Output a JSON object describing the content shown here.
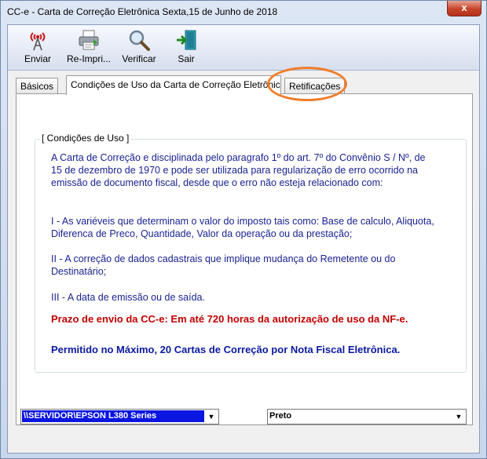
{
  "window": {
    "title": "CC-e - Carta de Correção Eletrônica Sexta,15 de Junho de 2018",
    "close_label": "x"
  },
  "toolbar": {
    "buttons": [
      {
        "label": "Enviar",
        "icon": "antenna-icon"
      },
      {
        "label": "Re-Impri...",
        "icon": "printer-icon"
      },
      {
        "label": "Verificar",
        "icon": "magnifier-icon"
      },
      {
        "label": "Sair",
        "icon": "exit-door-icon"
      }
    ]
  },
  "tabs": [
    {
      "label": "Básicos",
      "active": false
    },
    {
      "label": "Condições de Uso da Carta de Correção Eletrônica",
      "active": true
    },
    {
      "label": "Retificações",
      "active": false
    }
  ],
  "conditions": {
    "group_title": "[ Condições de Uso ]",
    "intro": "A Carta de Correção e disciplinada pelo paragrafo 1º do art. 7º do Convênio S / Nº, de 15 de dezembro de 1970 e pode ser utilizada para regularização de erro ocorrido na emissão de documento fiscal, desde que o erro não esteja relacionado com:",
    "item1": "I - As variéveis que determinam o valor do imposto tais como: Base de calculo, Aliquota, Diferenca de Preco, Quantidade, Valor da operação ou da prestação;",
    "item2": "II - A correção de dados cadastrais que implique mudança do Remetente ou do Destinatário;",
    "item3": "III - A data de emissão ou de saída.",
    "deadline": "Prazo de envio da CC-e: Em até 720 horas da autorização de uso da NF-e.",
    "limit": "Permitido no Máximo, 20 Cartas de Correção por Nota Fiscal Eletrônica."
  },
  "printer_select": {
    "value": "\\\\SERVIDOR\\EPSON L380 Series"
  },
  "color_select": {
    "value": "Preto"
  },
  "colors": {
    "body_text": "#1a2390",
    "deadline_text": "#c00000",
    "limit_text": "#0a1aa0",
    "highlight_ring": "#f07d2a",
    "printer_select_bg": "#0b16e0"
  }
}
